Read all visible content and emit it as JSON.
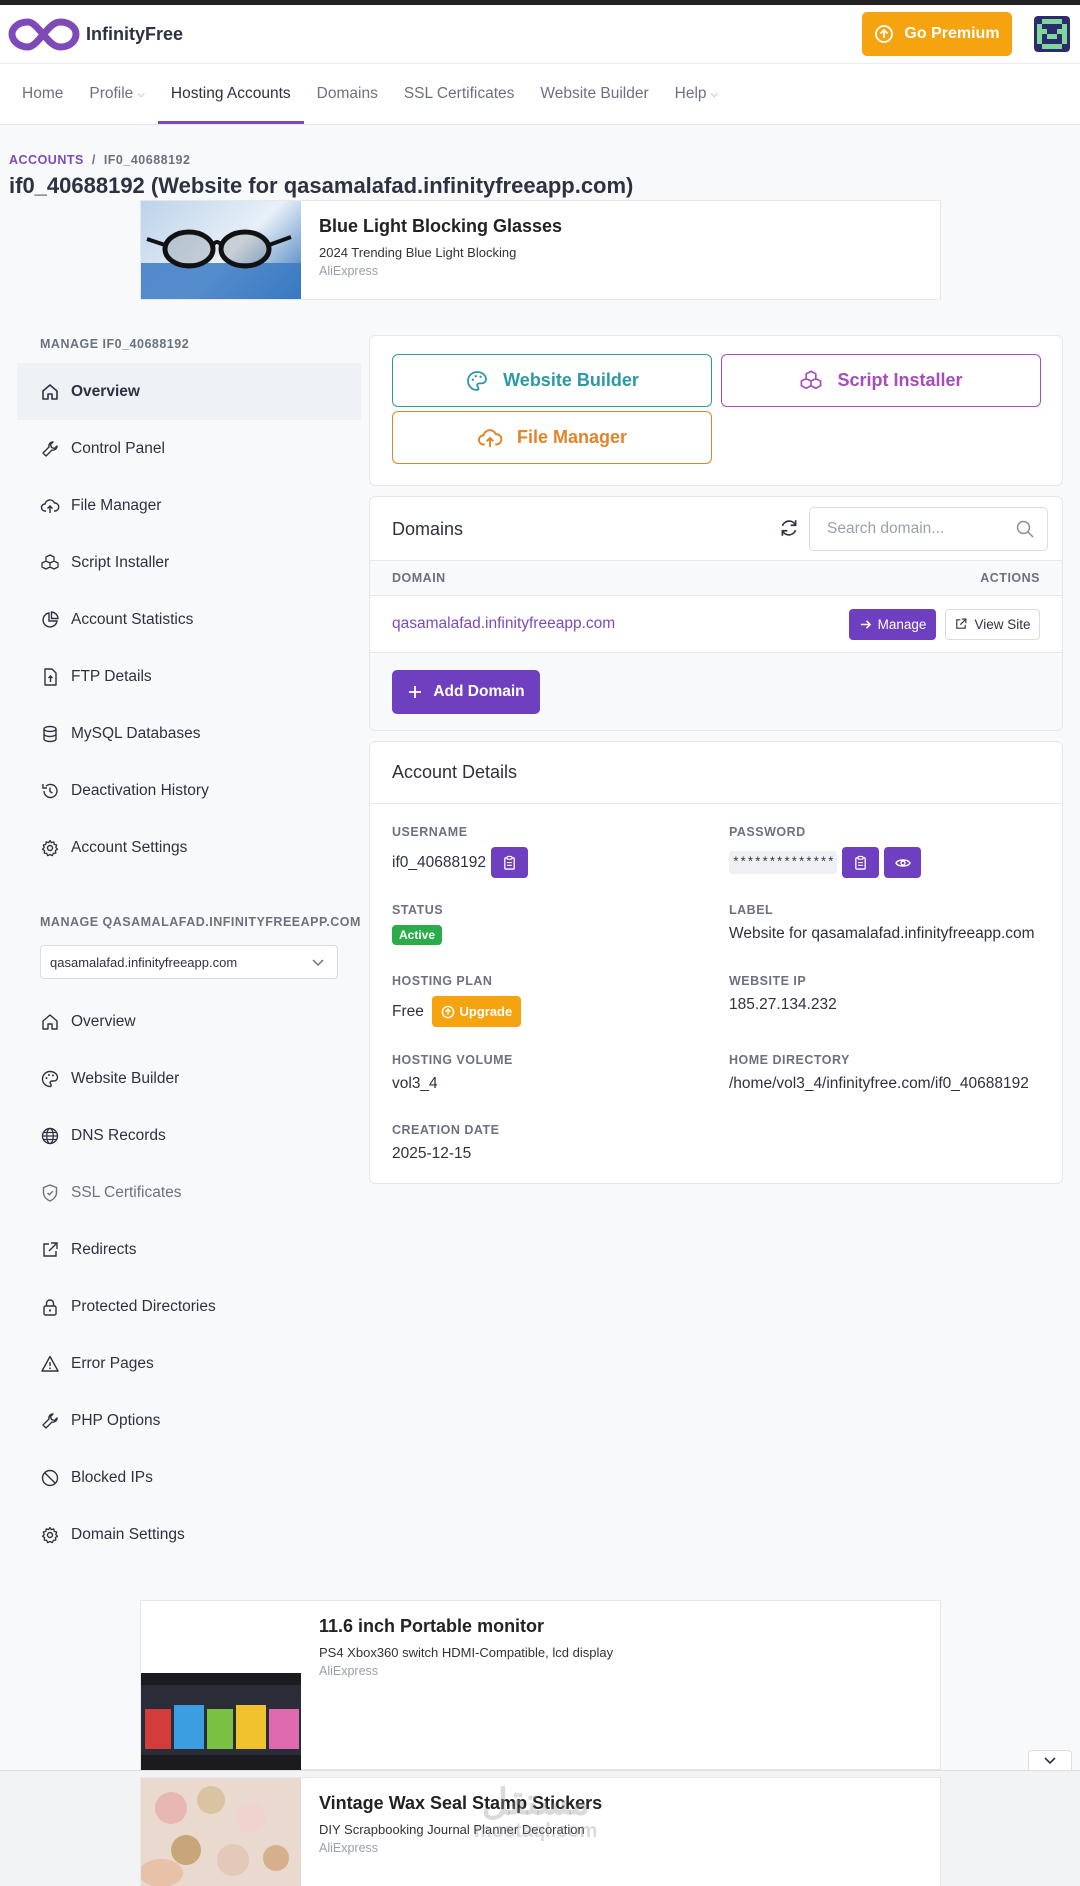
{
  "brand": {
    "name": "InfinityFree"
  },
  "header": {
    "premium_label": "Go Premium"
  },
  "nav": [
    {
      "label": "Home",
      "dropdown": false
    },
    {
      "label": "Profile",
      "dropdown": true
    },
    {
      "label": "Hosting Accounts",
      "dropdown": false,
      "active": true
    },
    {
      "label": "Domains",
      "dropdown": false
    },
    {
      "label": "SSL Certificates",
      "dropdown": false
    },
    {
      "label": "Website Builder",
      "dropdown": false
    },
    {
      "label": "Help",
      "dropdown": true
    }
  ],
  "breadcrumb": {
    "root": "ACCOUNTS",
    "separator": "/",
    "current": "IF0_40688192"
  },
  "page_title": "if0_40688192 (Website for qasamalafad.infinityfreeapp.com)",
  "ads": [
    {
      "title": "Blue Light Blocking Glasses",
      "desc": "2024 Trending Blue Light Blocking",
      "source": "AliExpress"
    },
    {
      "title": "11.6 inch Portable monitor",
      "desc": "PS4 Xbox360 switch HDMI-Compatible, lcd display",
      "source": "AliExpress"
    },
    {
      "title": "Vintage Wax Seal Stamp Stickers",
      "desc": "DIY Scrapbooking Journal Planner Decoration",
      "source": "AliExpress"
    }
  ],
  "sidebar": {
    "account_heading": "MANAGE IF0_40688192",
    "account_items": [
      {
        "label": "Overview",
        "icon": "home-icon"
      },
      {
        "label": "Control Panel",
        "icon": "wrench-icon"
      },
      {
        "label": "File Manager",
        "icon": "cloud-upload-icon"
      },
      {
        "label": "Script Installer",
        "icon": "cubes-icon"
      },
      {
        "label": "Account Statistics",
        "icon": "pie-chart-icon"
      },
      {
        "label": "FTP Details",
        "icon": "file-upload-icon"
      },
      {
        "label": "MySQL Databases",
        "icon": "database-icon"
      },
      {
        "label": "Deactivation History",
        "icon": "history-icon"
      },
      {
        "label": "Account Settings",
        "icon": "gear-icon"
      }
    ],
    "domain_heading": "MANAGE QASAMALAFAD.INFINITYFREEAPP.COM",
    "domain_select": "qasamalafad.infinityfreeapp.com",
    "domain_items": [
      {
        "label": "Overview",
        "icon": "home-icon"
      },
      {
        "label": "Website Builder",
        "icon": "palette-icon"
      },
      {
        "label": "DNS Records",
        "icon": "globe-icon"
      },
      {
        "label": "SSL Certificates",
        "icon": "shield-icon"
      },
      {
        "label": "Redirects",
        "icon": "external-link-icon"
      },
      {
        "label": "Protected Directories",
        "icon": "lock-icon"
      },
      {
        "label": "Error Pages",
        "icon": "warning-icon"
      },
      {
        "label": "PHP Options",
        "icon": "wrench-icon"
      },
      {
        "label": "Blocked IPs",
        "icon": "ban-icon"
      },
      {
        "label": "Domain Settings",
        "icon": "gear-icon"
      }
    ]
  },
  "quick_actions": {
    "website_builder": "Website Builder",
    "script_installer": "Script Installer",
    "file_manager": "File Manager"
  },
  "domains_card": {
    "title": "Domains",
    "search_placeholder": "Search domain...",
    "col_domain": "DOMAIN",
    "col_actions": "ACTIONS",
    "rows": [
      {
        "domain": "qasamalafad.infinityfreeapp.com"
      }
    ],
    "manage_label": "Manage",
    "view_label": "View Site",
    "add_label": "Add Domain"
  },
  "account_details": {
    "title": "Account Details",
    "username_label": "USERNAME",
    "username": "if0_40688192",
    "password_label": "PASSWORD",
    "password_mask": "**************",
    "status_label": "STATUS",
    "status": "Active",
    "label_label": "LABEL",
    "label": "Website for qasamalafad.infinityfreeapp.com",
    "plan_label": "HOSTING PLAN",
    "plan": "Free",
    "upgrade_label": "Upgrade",
    "ip_label": "WEBSITE IP",
    "ip": "185.27.134.232",
    "volume_label": "HOSTING VOLUME",
    "volume": "vol3_4",
    "homedir_label": "HOME DIRECTORY",
    "homedir": "/home/vol3_4/infinityfree.com/if0_40688192",
    "created_label": "CREATION DATE",
    "created": "2025-12-15"
  },
  "watermark": {
    "line1": "مستقل",
    "line2": "mostaql.com"
  },
  "colors": {
    "accent": "#6e3fbf",
    "premium": "#f5a30f",
    "success": "#2bab4a"
  }
}
